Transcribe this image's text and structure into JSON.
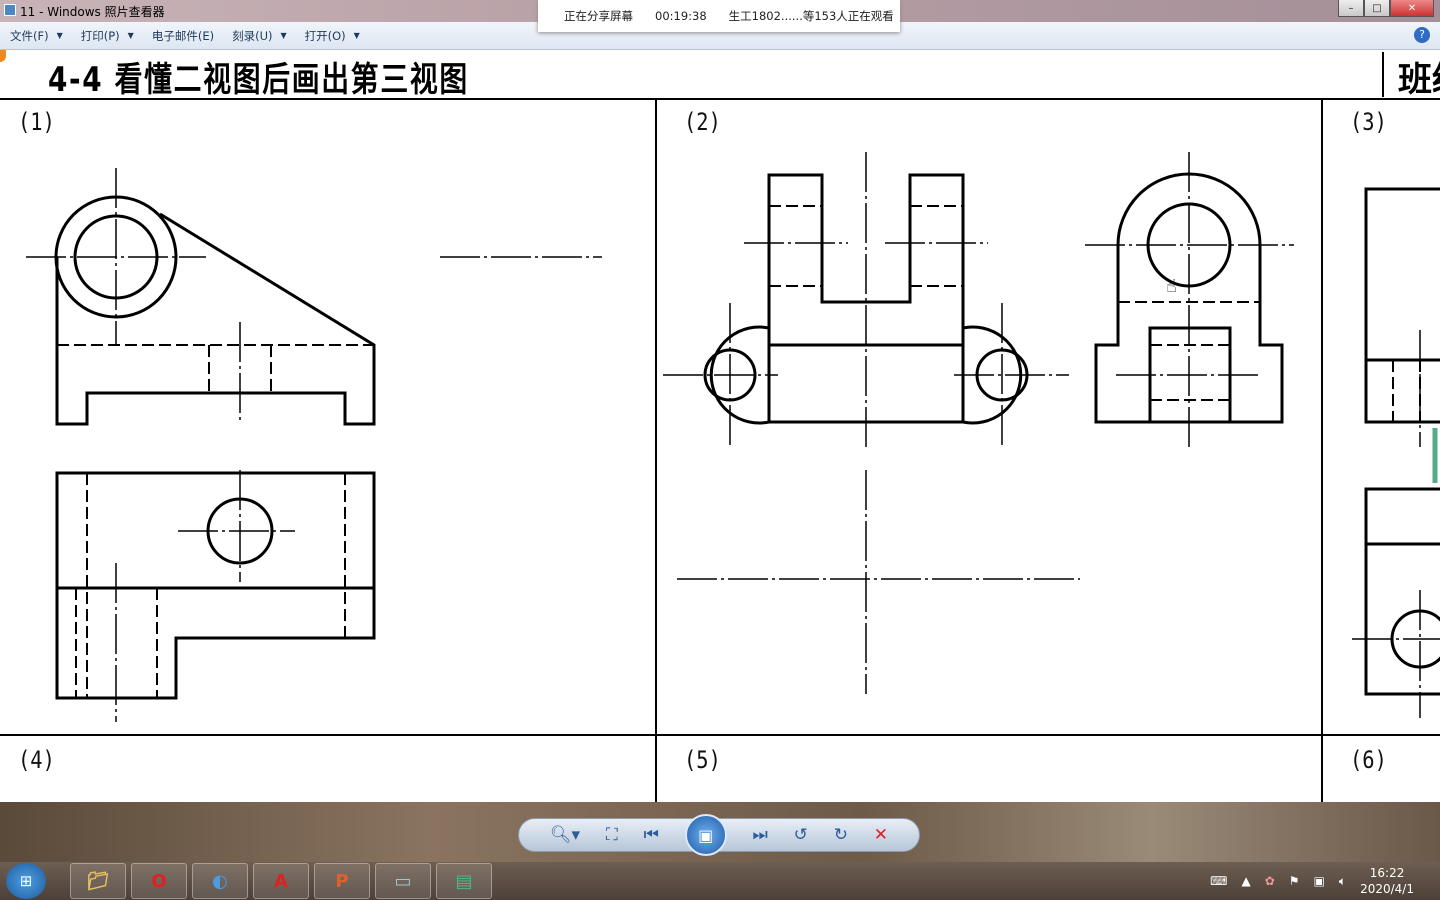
{
  "window": {
    "title": "11 - Windows 照片查看器"
  },
  "share_banner": {
    "status": "正在分享屏幕",
    "elapsed": "00:19:38",
    "viewers": "生工1802......等153人正在观看"
  },
  "menu": [
    {
      "label": "文件(F)"
    },
    {
      "label": "打印(P)"
    },
    {
      "label": "电子邮件(E)"
    },
    {
      "label": "刻录(U)"
    },
    {
      "label": "打开(O)"
    }
  ],
  "document": {
    "title": "4-4  看懂二视图后画出第三视图",
    "class_label": "班级",
    "problems": [
      "(1)",
      "(2)",
      "(3)",
      "(4)",
      "(5)",
      "(6)"
    ]
  },
  "viewer_toolbar": {
    "zoom": "zoom-icon",
    "fit": "actual-size-icon",
    "prev": "previous-icon",
    "slideshow": "slideshow-icon",
    "next": "next-icon",
    "rotate_ccw": "rotate-ccw-icon",
    "rotate_cw": "rotate-cw-icon",
    "delete": "delete-icon"
  },
  "taskbar": {
    "apps": [
      "explorer",
      "opera",
      "browser",
      "autocad",
      "powerpoint",
      "photo-viewer",
      "other-app"
    ],
    "time": "16:22",
    "date": "2020/4/1"
  }
}
